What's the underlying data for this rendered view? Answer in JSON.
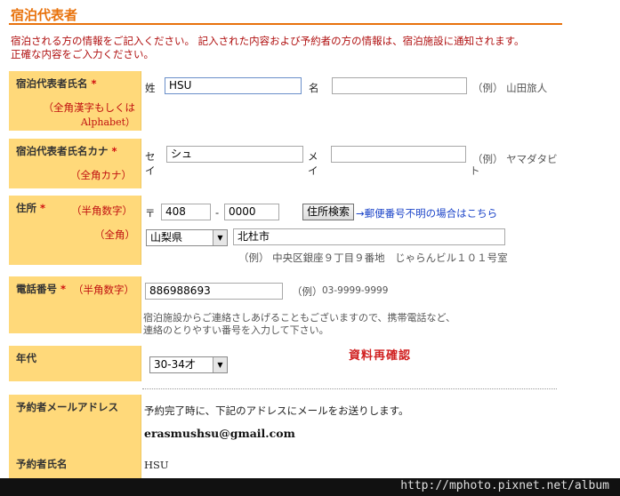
{
  "section_title": "宿泊代表者",
  "intro_lines": [
    "宿泊される方の情報をご記入ください。 記入された内容および予約者の方の情報は、宿泊施設に通知されます。",
    "正確な内容をご入力ください。"
  ],
  "required_mark": "*",
  "name": {
    "label": "宿泊代表者氏名",
    "note_line1": "（全角漢字もしくは",
    "note_line2": "Alphabet）",
    "sei_label": "姓",
    "sei_value": "HSU",
    "mei_label": "名",
    "mei_value": "",
    "example": "（例） 山田旅人"
  },
  "kana": {
    "label": "宿泊代表者氏名カナ",
    "note": "（全角カナ）",
    "sei_label_1": "セ",
    "sei_label_2": "イ",
    "sei_value": "シュ",
    "mei_label_1": "メ",
    "mei_label_2": "イ",
    "mei_value": "",
    "example": "（例） ヤマダタビ",
    "example_wrap": "ト"
  },
  "address": {
    "label": "住所",
    "note_half": "（半角数字）",
    "note_full": "（全角）",
    "postal_mark": "〒",
    "postal_1": "408",
    "dash": "-",
    "postal_2": "0000",
    "search_button": "住所検索",
    "unknown_link": "→郵便番号不明の場合はこちら",
    "prefecture": "山梨県",
    "city": "北杜市",
    "example": "（例） 中央区銀座９丁目９番地　じゃらんビル１０１号室"
  },
  "phone": {
    "label": "電話番号",
    "note": "（半角数字）",
    "value": "886988693",
    "example_prefix": "（例）",
    "example_value": "03-9999-9999",
    "help_line1": "宿泊施設からご連絡さしあげることもございますので、携帯電話など、",
    "help_line2": "連絡のとりやすい番号を入力して下さい。"
  },
  "age": {
    "label": "年代",
    "selected": "30-34才",
    "recheck": "資料再確認"
  },
  "email": {
    "label": "予約者メールアドレス",
    "message": "予約完了時に、下記のアドレスにメールをお送りします。",
    "value": "erasmushsu@gmail.com"
  },
  "booker": {
    "label": "予約者氏名",
    "value": "HSU"
  },
  "watermark": "http://mphoto.pixnet.net/album",
  "colors": {
    "accent": "#e8720c",
    "label_bg": "#ffd97a",
    "required": "#d01010",
    "link": "#1a43c8"
  }
}
